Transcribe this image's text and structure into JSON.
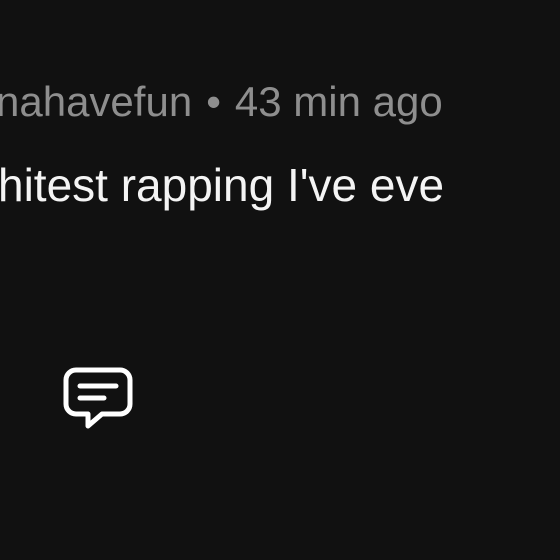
{
  "comment": {
    "username": "nahavefun",
    "separator": "•",
    "time_ago": "43 min ago",
    "text": "hitest rapping I've eve"
  },
  "actions": {
    "reply_icon": "message-square-icon"
  },
  "colors": {
    "background": "#111111",
    "meta_text": "#8e8e8e",
    "body_text": "#f4f4f4",
    "icon": "#ffffff"
  }
}
